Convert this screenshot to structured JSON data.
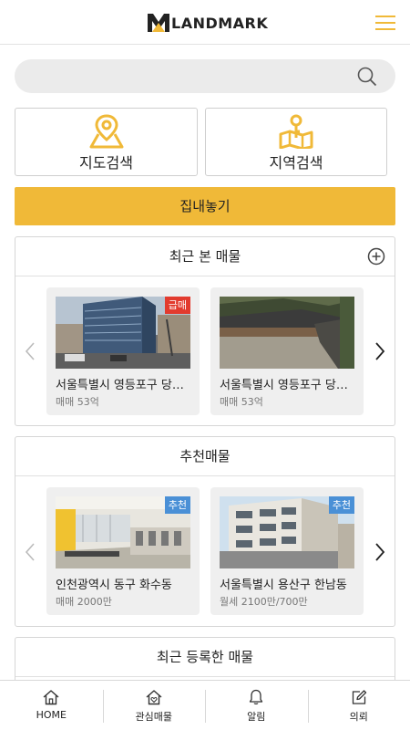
{
  "header": {
    "brand": "LANDMARK",
    "brand_color": "#f0b938",
    "menu_icon": "hamburger-icon"
  },
  "search": {
    "placeholder": "",
    "value": "",
    "icon": "search-icon"
  },
  "quick": [
    {
      "label": "지도검색",
      "icon": "map-pin-icon"
    },
    {
      "label": "지역검색",
      "icon": "map-key-icon"
    }
  ],
  "primary": {
    "label": "집내놓기",
    "color": "#f0b938"
  },
  "sections": {
    "recent_viewed": {
      "title": "최근 본 매물",
      "cards": [
        {
          "address": "서울특별시 영등포구 당산동",
          "price": "매매 53억",
          "badge": "급매"
        },
        {
          "address": "서울특별시 영등포구 당산동",
          "price": "매매 53억",
          "badge": ""
        }
      ]
    },
    "recommended": {
      "title": "추천매물",
      "cards": [
        {
          "address": "인천광역시 동구 화수동",
          "price": "매매 2000만",
          "badge": "추천"
        },
        {
          "address": "서울특별시 용산구 한남동",
          "price": "월세 2100만/700만",
          "badge": "추천"
        }
      ]
    },
    "recent_registered": {
      "title": "최근 등록한 매물"
    }
  },
  "tabs": [
    {
      "label": "HOME",
      "icon": "home-icon"
    },
    {
      "label": "관심매물",
      "icon": "heart-house-icon"
    },
    {
      "label": "알림",
      "icon": "bell-icon"
    },
    {
      "label": "의뢰",
      "icon": "edit-icon"
    }
  ]
}
